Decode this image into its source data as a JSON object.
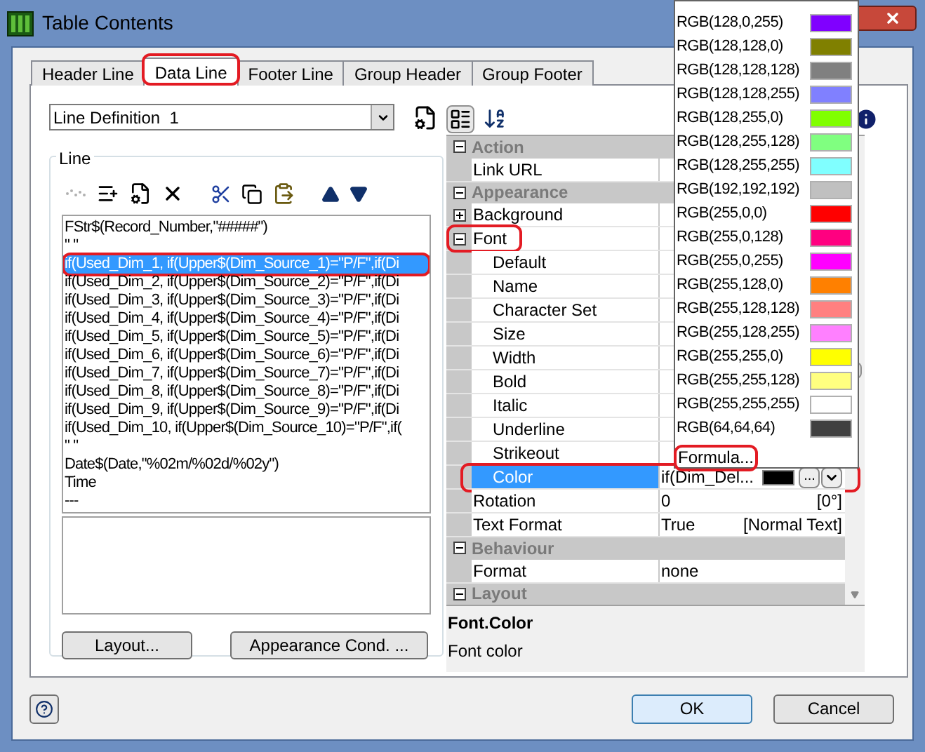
{
  "window": {
    "title": "Table Contents"
  },
  "tabs": [
    {
      "label": "Header Line",
      "selected": false,
      "marked": false
    },
    {
      "label": "Data Line",
      "selected": true,
      "marked": true
    },
    {
      "label": "Footer Line",
      "selected": false,
      "marked": false
    },
    {
      "label": "Group Header",
      "selected": false,
      "marked": false
    },
    {
      "label": "Group Footer",
      "selected": false,
      "marked": false
    }
  ],
  "line_definition": {
    "value": "Line Definition  1"
  },
  "line_group": {
    "label": "Line",
    "lines": [
      {
        "text": "FStr$(Record_Number,\"#####\")",
        "selected": false,
        "marked": false
      },
      {
        "text": "\" \"",
        "selected": false,
        "marked": false
      },
      {
        "text": "if(Used_Dim_1, if(Upper$(Dim_Source_1)=\"P/F\",if(Di",
        "selected": true,
        "marked": true
      },
      {
        "text": "if(Used_Dim_2, if(Upper$(Dim_Source_2)=\"P/F\",if(Di",
        "selected": false,
        "marked": false
      },
      {
        "text": "if(Used_Dim_3, if(Upper$(Dim_Source_3)=\"P/F\",if(Di",
        "selected": false,
        "marked": false
      },
      {
        "text": "if(Used_Dim_4, if(Upper$(Dim_Source_4)=\"P/F\",if(Di",
        "selected": false,
        "marked": false
      },
      {
        "text": "if(Used_Dim_5, if(Upper$(Dim_Source_5)=\"P/F\",if(Di",
        "selected": false,
        "marked": false
      },
      {
        "text": "if(Used_Dim_6, if(Upper$(Dim_Source_6)=\"P/F\",if(Di",
        "selected": false,
        "marked": false
      },
      {
        "text": "if(Used_Dim_7, if(Upper$(Dim_Source_7)=\"P/F\",if(Di",
        "selected": false,
        "marked": false
      },
      {
        "text": "if(Used_Dim_8, if(Upper$(Dim_Source_8)=\"P/F\",if(Di",
        "selected": false,
        "marked": false
      },
      {
        "text": "if(Used_Dim_9, if(Upper$(Dim_Source_9)=\"P/F\",if(Di",
        "selected": false,
        "marked": false
      },
      {
        "text": "if(Used_Dim_10, if(Upper$(Dim_Source_10)=\"P/F\",if(",
        "selected": false,
        "marked": false
      },
      {
        "text": "\" \"",
        "selected": false,
        "marked": false
      },
      {
        "text": "Date$(Date,\"%02m/%02d/%02y\")",
        "selected": false,
        "marked": false
      },
      {
        "text": "Time",
        "selected": false,
        "marked": false
      },
      {
        "text": "---",
        "selected": false,
        "marked": false
      }
    ],
    "buttons": [
      "Layout...",
      "Appearance Cond. ..."
    ]
  },
  "properties": {
    "categories": [
      {
        "label": "Action",
        "expanded": true,
        "children": [
          {
            "label": "Link URL",
            "selected": false
          }
        ]
      },
      {
        "label": "Appearance",
        "expanded": true,
        "children": [
          {
            "label": "Background",
            "expanded": false,
            "selected": false
          },
          {
            "label": "Font",
            "expanded": true,
            "marked": true,
            "selected": false,
            "children": [
              {
                "label": "Default",
                "selected": false
              },
              {
                "label": "Name",
                "selected": false
              },
              {
                "label": "Character Set",
                "selected": false
              },
              {
                "label": "Size",
                "selected": false
              },
              {
                "label": "Width",
                "selected": false
              },
              {
                "label": "Bold",
                "selected": false
              },
              {
                "label": "Italic",
                "selected": false
              },
              {
                "label": "Underline",
                "selected": false
              },
              {
                "label": "Strikeout",
                "selected": false
              },
              {
                "label": "Color",
                "selected": true,
                "marked": true,
                "value": "if(Dim_Del...",
                "color": "#000000",
                "button_label": "..."
              }
            ]
          },
          {
            "label": "Rotation",
            "selected": false,
            "value": "0",
            "hint": "[0°]"
          },
          {
            "label": "Text Format",
            "selected": false,
            "value": "True",
            "hint": "[Normal Text]"
          }
        ]
      },
      {
        "label": "Behaviour",
        "expanded": true,
        "children": [
          {
            "label": "Format",
            "selected": false,
            "value": "none"
          }
        ]
      },
      {
        "label": "Layout",
        "expanded": true
      }
    ],
    "description": {
      "title": "Font.Color",
      "text": "Font color"
    }
  },
  "color_dropdown": {
    "items": [
      {
        "label": "RGB(128,0,255)",
        "color": "#8000ff"
      },
      {
        "label": "RGB(128,128,0)",
        "color": "#808000"
      },
      {
        "label": "RGB(128,128,128)",
        "color": "#808080"
      },
      {
        "label": "RGB(128,128,255)",
        "color": "#8080ff"
      },
      {
        "label": "RGB(128,255,0)",
        "color": "#80ff00"
      },
      {
        "label": "RGB(128,255,128)",
        "color": "#80ff80"
      },
      {
        "label": "RGB(128,255,255)",
        "color": "#80ffff"
      },
      {
        "label": "RGB(192,192,192)",
        "color": "#c0c0c0"
      },
      {
        "label": "RGB(255,0,0)",
        "color": "#ff0000"
      },
      {
        "label": "RGB(255,0,128)",
        "color": "#ff0080"
      },
      {
        "label": "RGB(255,0,255)",
        "color": "#ff00ff"
      },
      {
        "label": "RGB(255,128,0)",
        "color": "#ff8000"
      },
      {
        "label": "RGB(255,128,128)",
        "color": "#ff8080"
      },
      {
        "label": "RGB(255,128,255)",
        "color": "#ff80ff"
      },
      {
        "label": "RGB(255,255,0)",
        "color": "#ffff00"
      },
      {
        "label": "RGB(255,255,128)",
        "color": "#ffff80"
      },
      {
        "label": "RGB(255,255,255)",
        "color": "#ffffff"
      },
      {
        "label": "RGB(64,64,64)",
        "color": "#404040"
      }
    ],
    "formula": {
      "label": "Formula...",
      "marked": true
    }
  },
  "footer": {
    "buttons": [
      {
        "label": "OK",
        "default": true
      },
      {
        "label": "Cancel",
        "default": false
      }
    ]
  }
}
